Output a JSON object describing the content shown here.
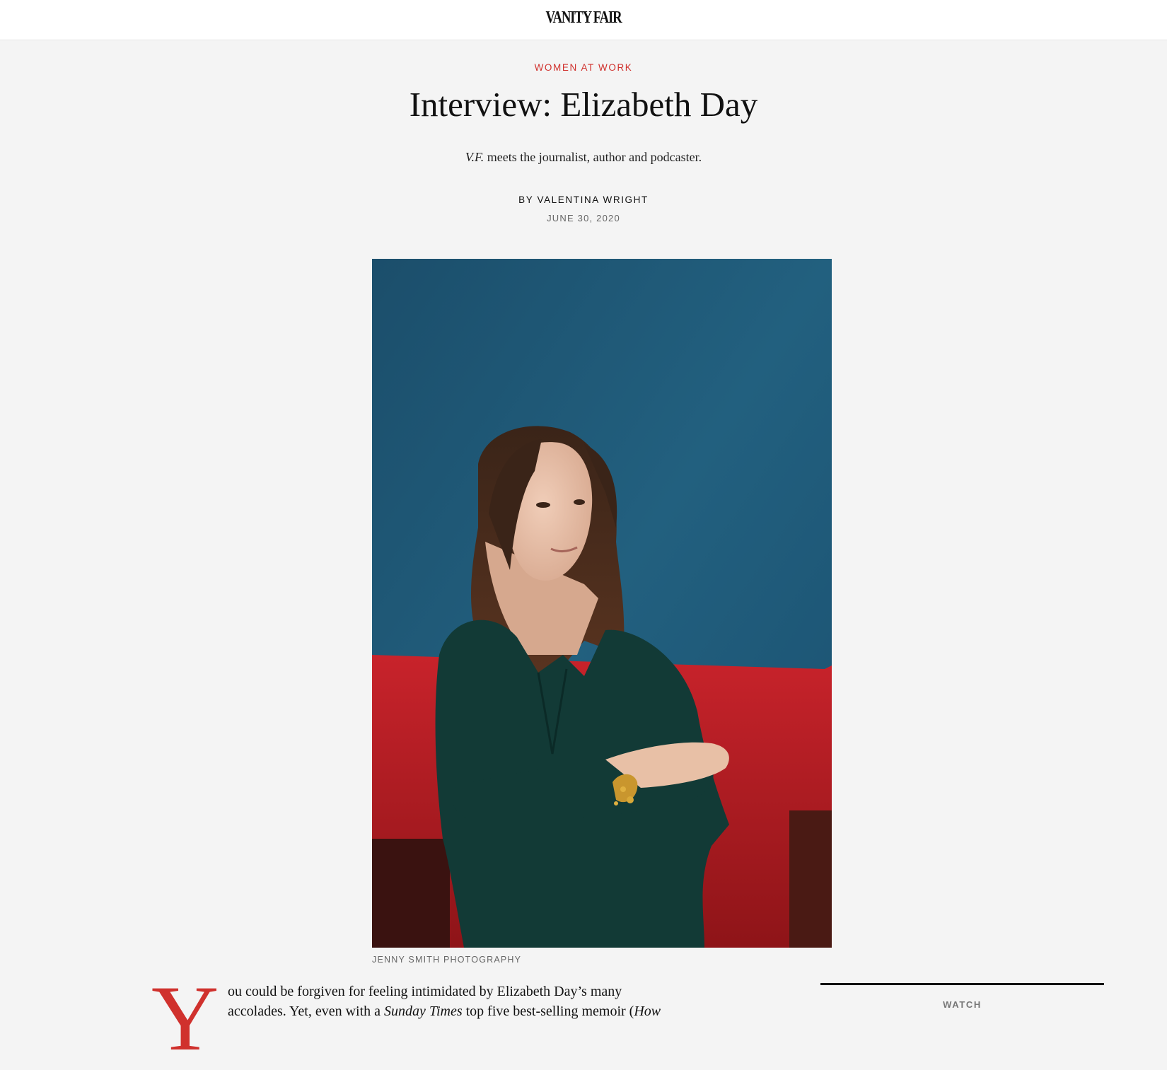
{
  "header": {
    "logo_text": "VANITY FAIR"
  },
  "article": {
    "kicker": "WOMEN AT WORK",
    "headline": "Interview: Elizabeth Day",
    "dek_em": "V.F.",
    "dek_rest": " meets the journalist, author and podcaster.",
    "byline": "BY VALENTINA WRIGHT",
    "date": "JUNE 30, 2020",
    "photo_credit": "JENNY SMITH PHOTOGRAPHY",
    "drop_cap": "Y",
    "body": {
      "line1": "ou could be forgiven for feeling intimidated by Elizabeth Day’s many",
      "line2_a": "accolades. Yet, even with a ",
      "line2_em": "Sunday Times",
      "line2_b": " top five best-selling memoir (",
      "line2_em2": "How"
    }
  },
  "sidebar": {
    "label": "WATCH"
  },
  "colors": {
    "accent_red": "#d0312d",
    "page_bg": "#f4f4f4",
    "photo_wall_blue": "#1f5a7a",
    "sofa_red": "#b81c22",
    "outfit_green": "#123a36"
  }
}
